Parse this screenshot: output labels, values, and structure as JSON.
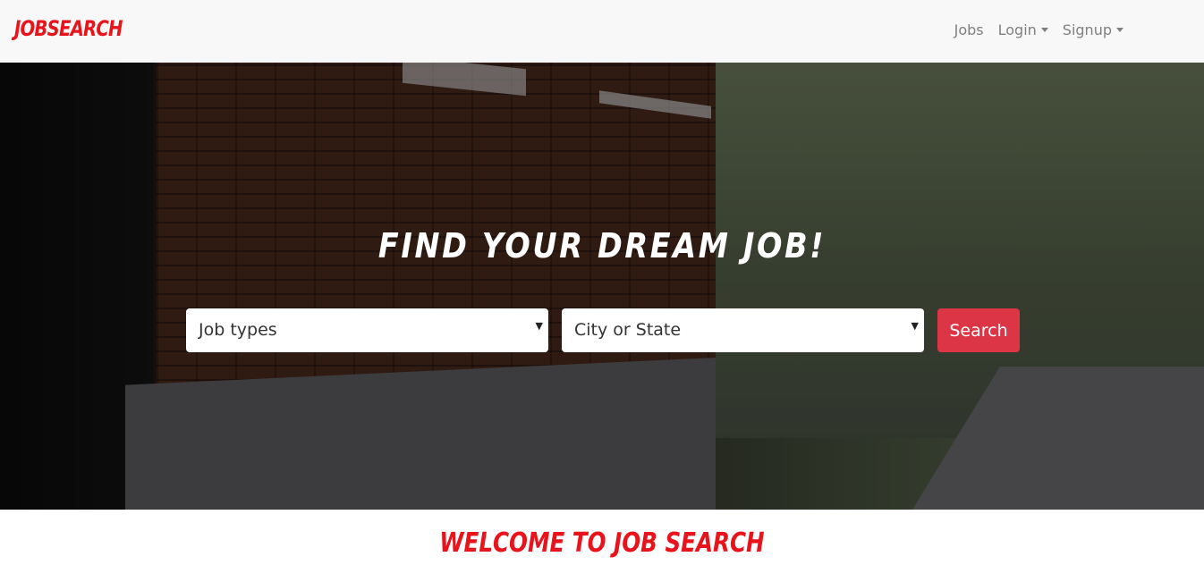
{
  "brand": "JOBSEARCH",
  "nav": {
    "jobs": "Jobs",
    "login": "Login",
    "signup": "Signup"
  },
  "hero": {
    "title": "FIND YOUR DREAM JOB!",
    "job_types_value": "Job types",
    "city_value": "City or State",
    "search_label": "Search"
  },
  "welcome": "WELCOME TO JOB SEARCH",
  "colors": {
    "brand": "#e8131b",
    "search_button": "#dc3545"
  }
}
